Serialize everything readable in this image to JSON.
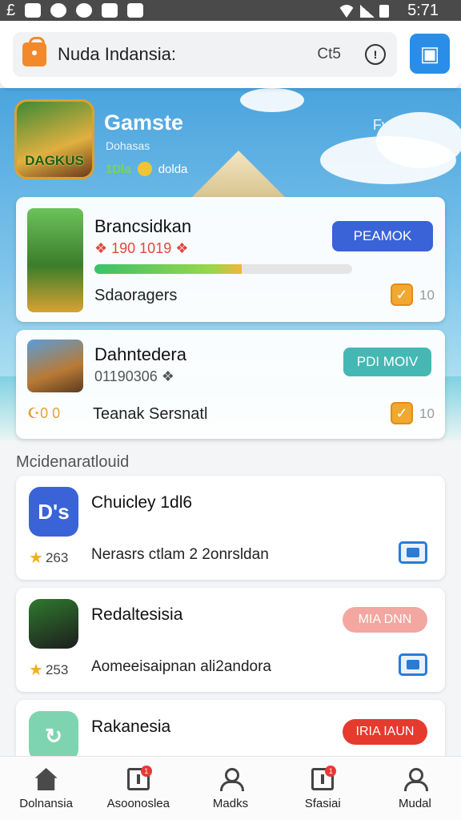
{
  "status_bar": {
    "left_text": "£",
    "time": "5:71"
  },
  "search": {
    "placeholder": "Nuda Indansia:",
    "meta": "Ct5",
    "info": "!"
  },
  "banner": {
    "title": "Gamste",
    "subtitle": "Dohasas",
    "stat_green": "1Dla",
    "stat_text": "dolda",
    "right_text": "Fyanobodo",
    "logo_text": "DAGKUS"
  },
  "featured": [
    {
      "title": "Brancsidkan",
      "code": "❖ 190 1019 ❖",
      "progress": 0.57,
      "label": "Sdaoragers",
      "button": "PEAMOK",
      "count": "10",
      "accent": "#3a63d8"
    },
    {
      "title": "Dahntedera",
      "code": "01190306 ❖",
      "prefix": "☪0 0",
      "label": "Teanak Sersnatl",
      "button": "PDI MOIV",
      "count": "10",
      "accent": "#45b8b4"
    }
  ],
  "section_title": "Mcidenaratlouid",
  "apps": [
    {
      "name": "Chuicley 1dl6",
      "icon_text": "D's",
      "rating": "263",
      "description": "Nerasrs ctlam 2 2onrsldan",
      "icon_color": "#3a63d8"
    },
    {
      "name": "Redaltesisia",
      "rating": "253",
      "description": "Aomeeisaipnan ali2andora",
      "pill": "MIA DNN",
      "pill_color": "#f2a7a0"
    },
    {
      "name": "Rakanesia",
      "pill": "IRIA IAUN",
      "pill_color": "#e53a2e",
      "icon_color": "#7fd4b0"
    }
  ],
  "nav": [
    {
      "label": "Dolnansia",
      "icon": "home-icon"
    },
    {
      "label": "Asoonoslea",
      "icon": "document-icon",
      "badge": "1"
    },
    {
      "label": "Madks",
      "icon": "user-icon"
    },
    {
      "label": "Sfasiai",
      "icon": "document-icon",
      "badge": "1"
    },
    {
      "label": "Mudal",
      "icon": "user-icon"
    }
  ]
}
